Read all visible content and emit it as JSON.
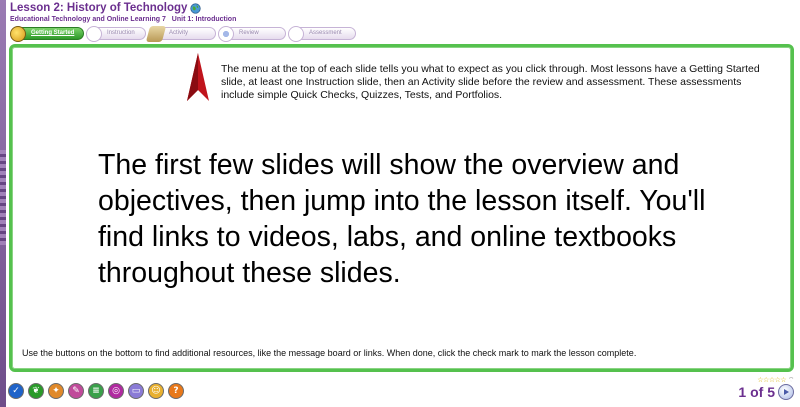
{
  "header": {
    "lesson_title": "Lesson 2: History of Technology",
    "course": "Educational Technology and Online Learning 7",
    "unit": "Unit 1: Introduction"
  },
  "nav_tabs": [
    {
      "label": "Getting Started",
      "active": true
    },
    {
      "label": "Instruction",
      "active": false
    },
    {
      "label": "Activity",
      "active": false
    },
    {
      "label": "Review",
      "active": false
    },
    {
      "label": "Assessment",
      "active": false
    }
  ],
  "content": {
    "intro_text": "The menu at the top of each slide tells you what to expect as you click through. Most lessons have a Getting Started slide, at least one Instruction slide, then an Activity slide before the review and assessment. These assessments include simple Quick Checks, Quizzes, Tests, and Portfolios.",
    "main_text": "The first few slides will show the overview and objectives, then jump into the lesson itself. You'll find links to videos, labs, and online textbooks throughout these slides.",
    "footer_note": "Use the buttons on the bottom to find additional resources, like the message board or links. When done, click the check mark to mark the lesson complete."
  },
  "bottom_buttons": [
    {
      "icon": "check-icon",
      "color": "#1f63c9"
    },
    {
      "icon": "leaf-icon",
      "color": "#2a9a2a"
    },
    {
      "icon": "puzzle-icon",
      "color": "#e0892a"
    },
    {
      "icon": "pencil-icon",
      "color": "#c04a9a"
    },
    {
      "icon": "notes-icon",
      "color": "#3aa04a"
    },
    {
      "icon": "target-icon",
      "color": "#b02aa0"
    },
    {
      "icon": "message-icon",
      "color": "#8a7bd6"
    },
    {
      "icon": "teacher-icon",
      "color": "#e8b030"
    },
    {
      "icon": "help-icon",
      "color": "#e8781a"
    }
  ],
  "pager": {
    "rating": "☆☆☆☆☆",
    "page_text": "1 of 5"
  },
  "colors": {
    "brand_purple": "#6b2f8f",
    "content_border": "#55c14e",
    "arrow_red": "#c0141c"
  }
}
